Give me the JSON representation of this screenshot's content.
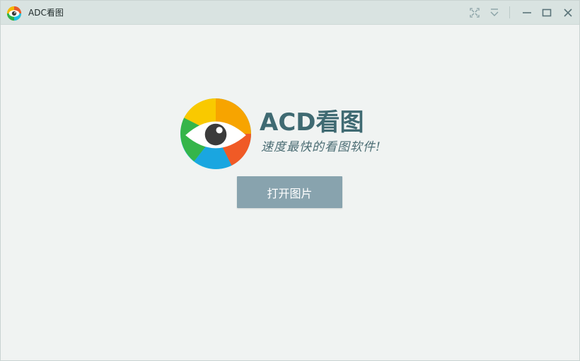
{
  "window": {
    "title": "ADC看图",
    "controls": {
      "fullscreen": "fullscreen-icon",
      "dropdown": "chevron-down-icon",
      "minimize": "minimize-icon",
      "maximize": "maximize-icon",
      "close": "close-icon"
    }
  },
  "brand": {
    "name": "ACD看图",
    "slogan": "速度最快的看图软件!",
    "colors": {
      "title": "#3f6a72",
      "slogan": "#4b6d74"
    }
  },
  "main": {
    "open_button_label": "打开图片",
    "open_button_color": "#88a3ae"
  },
  "theme": {
    "background": "#f0f3f2",
    "titlebar": "#d9e3e1"
  }
}
